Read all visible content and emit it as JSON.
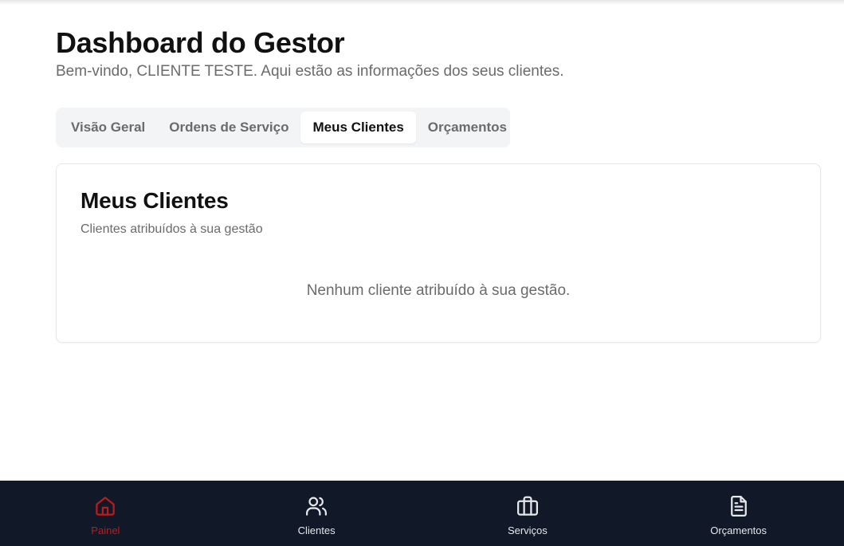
{
  "header": {
    "title": "Dashboard do Gestor",
    "subtitle": "Bem-vindo, CLIENTE TESTE. Aqui estão as informações dos seus clientes."
  },
  "tabs": [
    {
      "label": "Visão Geral",
      "active": false
    },
    {
      "label": "Ordens de Serviço",
      "active": false
    },
    {
      "label": "Meus Clientes",
      "active": true
    },
    {
      "label": "Orçamentos",
      "active": false
    }
  ],
  "card": {
    "title": "Meus Clientes",
    "description": "Clientes atribuídos à sua gestão",
    "empty_message": "Nenhum cliente atribuído à sua gestão."
  },
  "bottom_nav": {
    "items": [
      {
        "label": "Painel",
        "icon": "home-icon",
        "active": true
      },
      {
        "label": "Clientes",
        "icon": "users-icon",
        "active": false
      },
      {
        "label": "Serviços",
        "icon": "briefcase-icon",
        "active": false
      },
      {
        "label": "Orçamentos",
        "icon": "file-text-icon",
        "active": false
      }
    ],
    "colors": {
      "active": "#b91c1c",
      "inactive": "#e5e7eb",
      "background": "#111827"
    }
  }
}
